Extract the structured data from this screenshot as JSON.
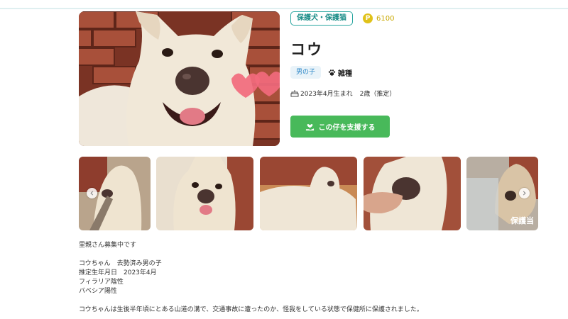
{
  "header": {
    "type_badge": "保護犬・保護猫"
  },
  "points": {
    "icon": "P",
    "value": "6100"
  },
  "dog": {
    "name": "コウ",
    "sex_tag": "男の子",
    "breed": "雑種",
    "birth": "2023年4月生まれ",
    "age": "2歳（推定）"
  },
  "support_button": {
    "label": "この仔を支援する"
  },
  "gallery": {
    "watermark": "保護当"
  },
  "description": {
    "lines": [
      "里親さん募集中です",
      "",
      "コウちゃん　去勢済み男の子",
      "推定生年月日　2023年4月",
      "フィラリア陰性",
      "バベシア陽性",
      "",
      "コウちゃんは生後半年頃にとある山道の溝で、交通事故に遭ったのか、怪我をしている状態で保健所に保護されました。"
    ]
  },
  "colors": {
    "teal": "#2aa6a0",
    "green": "#48b95a",
    "gold": "#e0c21a",
    "blue_tag": "#2a86c7"
  }
}
